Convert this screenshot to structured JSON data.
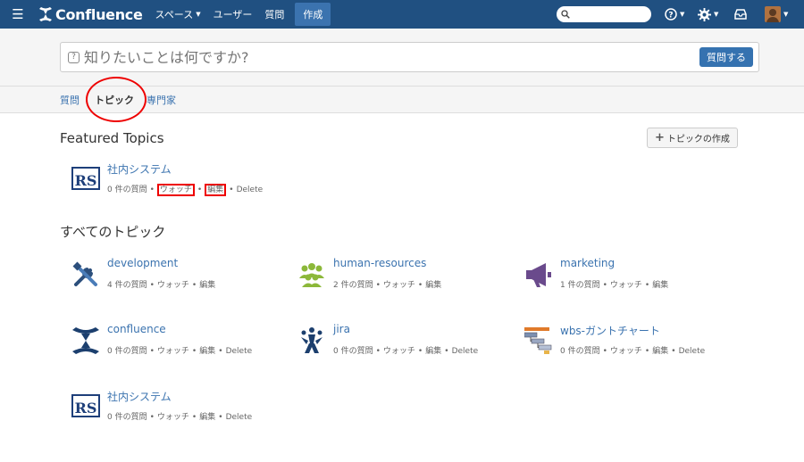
{
  "header": {
    "brand": "Confluence",
    "nav": [
      "スペース",
      "ユーザー",
      "質問"
    ],
    "create_label": "作成",
    "search_placeholder": ""
  },
  "ask": {
    "placeholder": "知りたいことは何ですか?",
    "button": "質問する"
  },
  "tabs": [
    "質問",
    "トピック",
    "専門家"
  ],
  "active_tab": "トピック",
  "featured": {
    "heading": "Featured Topics",
    "create_button": "トピックの作成",
    "topics": [
      {
        "name": "社内システム",
        "count": "0 件の質問",
        "watch": "ウォッチ",
        "edit": "編集",
        "delete": "Delete",
        "icon": "rs-logo-icon"
      }
    ]
  },
  "all_topics": {
    "heading": "すべてのトピック",
    "topics": [
      {
        "name": "development",
        "count": "4 件の質問",
        "watch": "ウォッチ",
        "edit": "編集",
        "delete": "",
        "icon": "tools-icon"
      },
      {
        "name": "human-resources",
        "count": "2 件の質問",
        "watch": "ウォッチ",
        "edit": "編集",
        "delete": "",
        "icon": "people-icon"
      },
      {
        "name": "marketing",
        "count": "1 件の質問",
        "watch": "ウォッチ",
        "edit": "編集",
        "delete": "",
        "icon": "megaphone-icon"
      },
      {
        "name": "confluence",
        "count": "0 件の質問",
        "watch": "ウォッチ",
        "edit": "編集",
        "delete": "Delete",
        "icon": "confluence-logo-icon"
      },
      {
        "name": "jira",
        "count": "0 件の質問",
        "watch": "ウォッチ",
        "edit": "編集",
        "delete": "Delete",
        "icon": "jira-logo-icon"
      },
      {
        "name": "wbs-ガントチャート",
        "count": "0 件の質問",
        "watch": "ウォッチ",
        "edit": "編集",
        "delete": "Delete",
        "icon": "gantt-chart-icon"
      },
      {
        "name": "社内システム",
        "count": "0 件の質問",
        "watch": "ウォッチ",
        "edit": "編集",
        "delete": "Delete",
        "icon": "rs-logo-icon"
      }
    ]
  },
  "icon_text": {
    "rs": "RS"
  },
  "colors": {
    "header_bg": "#205081",
    "link": "#3b73af",
    "primary_button": "#3572b0",
    "annotation": "#e00000"
  }
}
